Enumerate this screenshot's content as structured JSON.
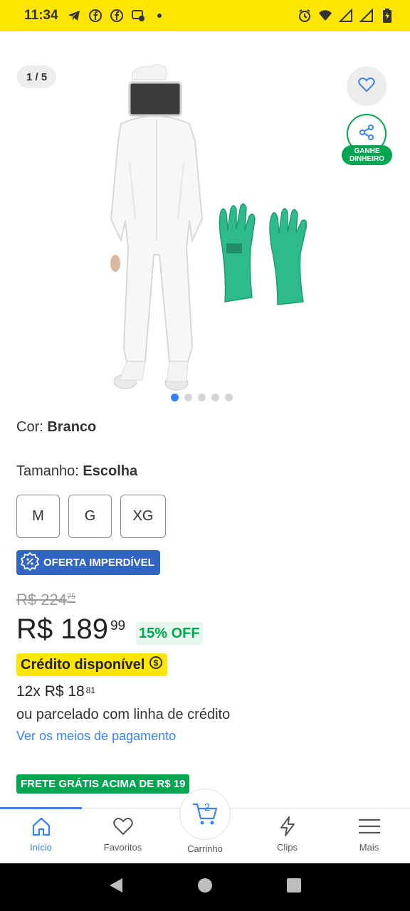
{
  "status_bar": {
    "time": "11:34",
    "left_icons": [
      "telegram-icon",
      "facebook-icon",
      "facebook-icon",
      "messenger-icon",
      "dot-icon"
    ],
    "right_icons": [
      "alarm-icon",
      "wifi-icon",
      "signal-icon",
      "signal-icon",
      "battery-icon"
    ],
    "bg_color": "#ffe600"
  },
  "gallery": {
    "counter": "1 / 5",
    "image_alt": "beekeeping-suit-and-green-gloves",
    "dots_total": 5,
    "dots_active": 1,
    "share_badge_line1": "GANHE",
    "share_badge_line2": "DINHEIRO"
  },
  "color_row": {
    "label": "Cor: ",
    "value": "Branco"
  },
  "size_row": {
    "label": "Tamanho: ",
    "value": "Escolha"
  },
  "sizes": [
    "M",
    "G",
    "XG"
  ],
  "offer_badge": "OFERTA IMPERDÍVEL",
  "pricing": {
    "old_price": "R$ 224",
    "old_cents": "75",
    "price": "R$ 189",
    "cents": "99",
    "discount": "15% OFF",
    "credit_badge": "Crédito disponível",
    "installments": "12x R$ 18",
    "installments_cents": "81",
    "credit_line": "ou parcelado com linha de crédito",
    "payment_link": "Ver os meios de pagamento"
  },
  "shipping_badge": "FRETE GRÁTIS ACIMA DE R$ 19",
  "bottom_nav": {
    "items": [
      {
        "label": "Início",
        "icon": "home-icon",
        "active": true
      },
      {
        "label": "Favoritos",
        "icon": "heart-icon",
        "active": false
      },
      {
        "label": "Carrinho",
        "icon": "cart-icon",
        "active": false
      },
      {
        "label": "Clips",
        "icon": "lightning-icon",
        "active": false
      },
      {
        "label": "Mais",
        "icon": "menu-icon",
        "active": false
      }
    ],
    "cart_count": "2"
  },
  "colors": {
    "accent_blue": "#3483fa",
    "green": "#00a650",
    "yellow": "#ffe600",
    "offer_blue": "#3065c3"
  }
}
